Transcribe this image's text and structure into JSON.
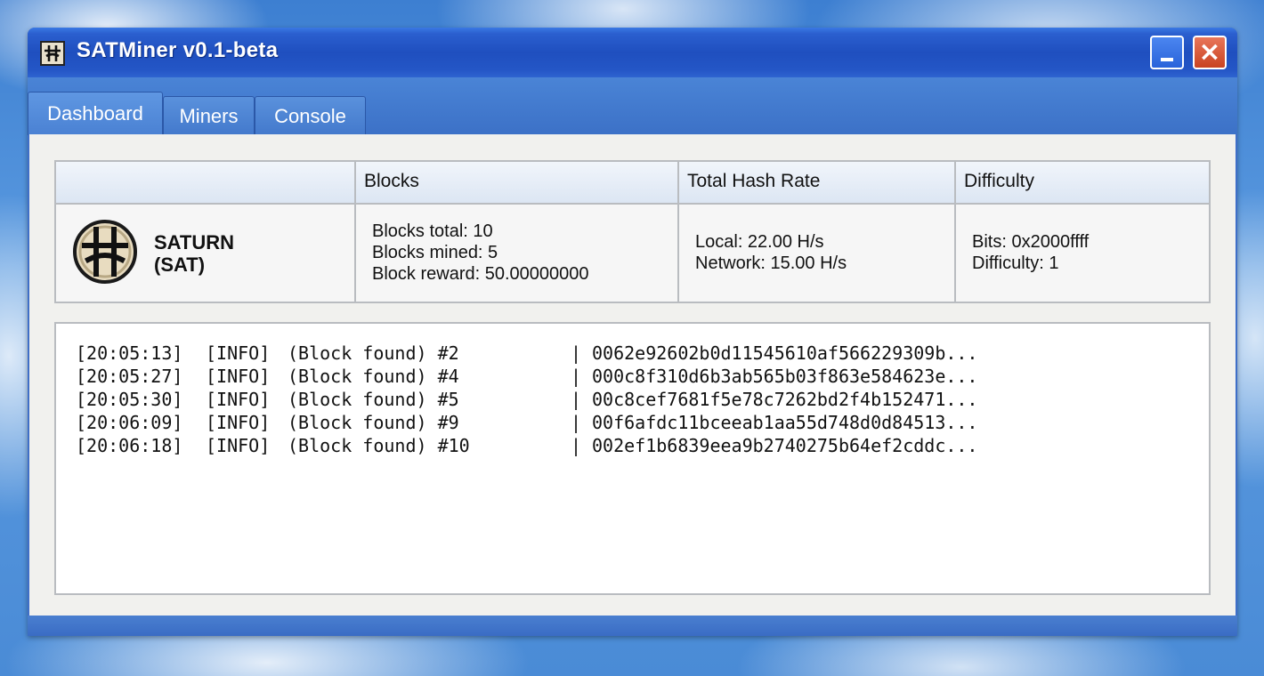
{
  "window": {
    "title": "SATMiner v0.1-beta"
  },
  "tabs": [
    {
      "label": "Dashboard",
      "active": true
    },
    {
      "label": "Miners",
      "active": false
    },
    {
      "label": "Console",
      "active": false
    }
  ],
  "dashboard": {
    "headers": {
      "coin": "",
      "blocks": "Blocks",
      "hash_rate": "Total Hash Rate",
      "difficulty": "Difficulty"
    },
    "coin": {
      "name": "SATURN",
      "ticker": "(SAT)"
    },
    "blocks": {
      "total": "Blocks total: 10",
      "mined": "Blocks mined: 5",
      "reward": "Block reward: 50.00000000"
    },
    "hash_rate": {
      "local": "Local: 22.00 H/s",
      "network": "Network: 15.00 H/s"
    },
    "difficulty": {
      "bits": "Bits: 0x2000ffff",
      "value": "Difficulty: 1"
    }
  },
  "log": [
    {
      "time": "[20:05:13]",
      "level": "[INFO]",
      "message": "(Block found) #2",
      "sep": "|",
      "hash": "0062e92602b0d11545610af566229309b..."
    },
    {
      "time": "[20:05:27]",
      "level": "[INFO]",
      "message": "(Block found) #4",
      "sep": "|",
      "hash": "000c8f310d6b3ab565b03f863e584623e..."
    },
    {
      "time": "[20:05:30]",
      "level": "[INFO]",
      "message": "(Block found) #5",
      "sep": "|",
      "hash": "00c8cef7681f5e78c7262bd2f4b152471..."
    },
    {
      "time": "[20:06:09]",
      "level": "[INFO]",
      "message": "(Block found) #9",
      "sep": "|",
      "hash": "00f6afdc11bceeab1aa55d748d0d84513..."
    },
    {
      "time": "[20:06:18]",
      "level": "[INFO]",
      "message": "(Block found) #10",
      "sep": "|",
      "hash": "002ef1b6839eea9b2740275b64ef2cddc..."
    }
  ],
  "colors": {
    "titlebar": "#1f4fbf",
    "close_button": "#c94321",
    "minimize_button": "#2a63da",
    "client_bg": "#f1f1ee"
  }
}
